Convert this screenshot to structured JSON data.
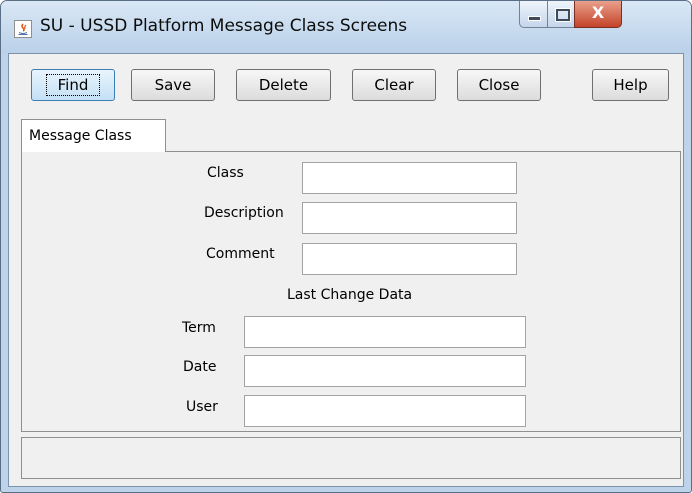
{
  "window": {
    "title": "SU - USSD Platform Message Class Screens",
    "close_glyph": "X",
    "icons": [
      "java-app-icon",
      "minimize-icon",
      "maximize-icon",
      "close-icon"
    ]
  },
  "toolbar": {
    "find_label": "Find",
    "save_label": "Save",
    "delete_label": "Delete",
    "clear_label": "Clear",
    "close_label": "Close",
    "help_label": "Help"
  },
  "tabs": [
    {
      "label": "Message Class",
      "selected": true
    }
  ],
  "form": {
    "class_label": "Class",
    "class_value": "",
    "description_label": "Description",
    "description_value": "",
    "comment_label": "Comment",
    "comment_value": "",
    "last_change_heading": "Last Change Data",
    "term_label": "Term",
    "term_value": "",
    "date_label": "Date",
    "date_value": "",
    "user_label": "User",
    "user_value": ""
  },
  "status": {
    "text": ""
  },
  "colors": {
    "titlebar": "#bcd3ea",
    "close_button": "#c4432a",
    "panel": "#f0f0f0",
    "default_button": "#c4e0f5"
  }
}
